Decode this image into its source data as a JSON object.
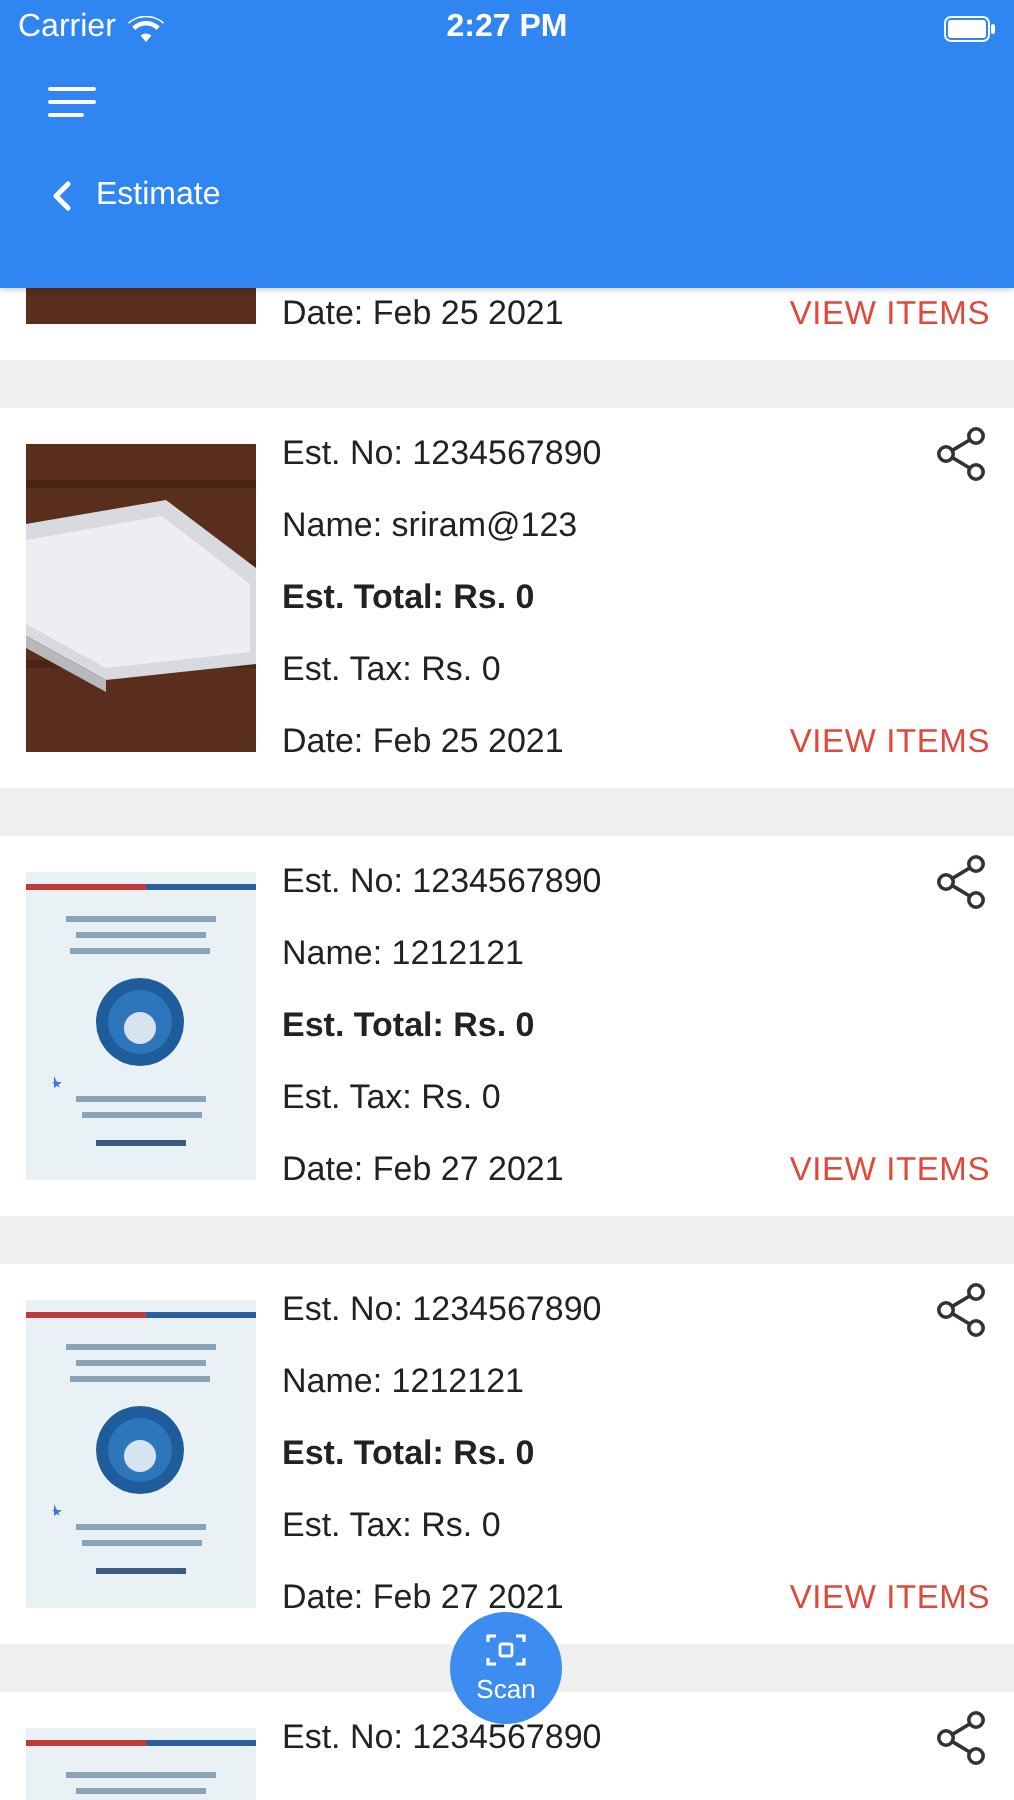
{
  "status_bar": {
    "carrier": "Carrier",
    "time": "2:27 PM"
  },
  "header": {
    "title": "Estimate"
  },
  "estimates": [
    {
      "picture": {
        "kind": "paper"
      },
      "lines": [
        {
          "kind": "date",
          "text": "Date:  Feb 25 2021"
        }
      ],
      "action": "VIEW ITEMS"
    },
    {
      "picture": {
        "kind": "paper"
      },
      "lines": [
        {
          "kind": "number",
          "text": "Est. No: 1234567890"
        },
        {
          "kind": "name",
          "text": "Name: sriram@123"
        },
        {
          "kind": "total",
          "text": "Est. Total: Rs. 0"
        },
        {
          "kind": "tax",
          "text": "Est. Tax: Rs. 0"
        },
        {
          "kind": "date",
          "text": "Date:  Feb 25 2021"
        }
      ],
      "action": "VIEW ITEMS"
    },
    {
      "picture": {
        "kind": "invitation"
      },
      "lines": [
        {
          "kind": "number",
          "text": "Est. No: 1234567890"
        },
        {
          "kind": "name",
          "text": "Name: 1212121"
        },
        {
          "kind": "total",
          "text": "Est. Total: Rs. 0"
        },
        {
          "kind": "tax",
          "text": "Est. Tax: Rs. 0"
        },
        {
          "kind": "date",
          "text": "Date:  Feb 27 2021"
        }
      ],
      "action": "VIEW ITEMS"
    },
    {
      "picture": {
        "kind": "invitation"
      },
      "lines": [
        {
          "kind": "number",
          "text": "Est. No: 1234567890"
        },
        {
          "kind": "name",
          "text": "Name: 1212121"
        },
        {
          "kind": "total",
          "text": "Est. Total: Rs. 0"
        },
        {
          "kind": "tax",
          "text": "Est. Tax: Rs. 0"
        },
        {
          "kind": "date",
          "text": "Date:  Feb 27 2021"
        }
      ],
      "action": "VIEW ITEMS"
    },
    {
      "picture": {
        "kind": "invitation"
      },
      "lines": [
        {
          "kind": "number",
          "text": "Est. No: 1234567890"
        }
      ]
    }
  ],
  "fab": {
    "label": "Scan"
  }
}
